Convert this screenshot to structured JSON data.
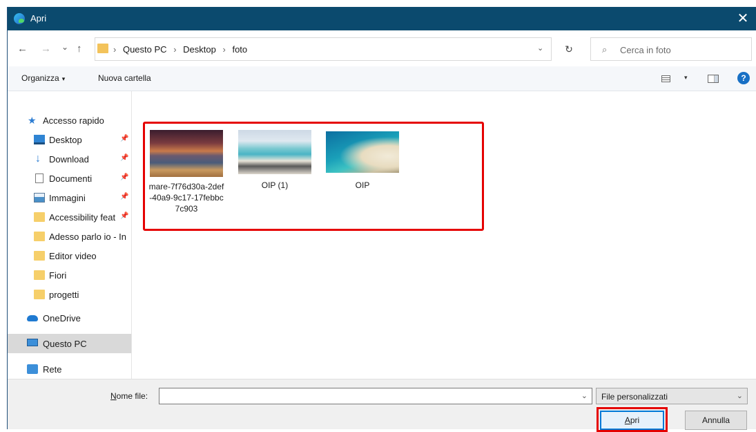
{
  "window": {
    "title": "Apri",
    "close_glyph": "✕"
  },
  "nav": {
    "back": "←",
    "forward": "→",
    "recent": "⌄",
    "up": "↑",
    "breadcrumb": [
      "Questo PC",
      "Desktop",
      "foto"
    ],
    "separator": "›",
    "dropdown": "⌄",
    "refresh": "↻",
    "search_placeholder": "Cerca in foto",
    "search_icon": "⌕"
  },
  "toolbar": {
    "organize": "Organizza",
    "organize_caret": "▾",
    "new_folder": "Nuova cartella",
    "view_caret": "▾",
    "help": "?"
  },
  "sidebar": {
    "items": [
      {
        "label": "Accesso rapido",
        "icon": "star-icon",
        "glyph": "★"
      },
      {
        "label": "Desktop",
        "icon": "desktop-icon",
        "pin": "📌"
      },
      {
        "label": "Download",
        "icon": "download-icon",
        "glyph": "↓",
        "pin": "📌"
      },
      {
        "label": "Documenti",
        "icon": "document-icon",
        "pin": "📌"
      },
      {
        "label": "Immagini",
        "icon": "pictures-icon",
        "pin": "📌"
      },
      {
        "label": "Accessibility feat",
        "icon": "folder-icon",
        "pin": "📌"
      },
      {
        "label": "Adesso parlo io - In",
        "icon": "folder-icon"
      },
      {
        "label": "Editor video",
        "icon": "folder-icon"
      },
      {
        "label": "Fiori",
        "icon": "folder-icon"
      },
      {
        "label": "progetti",
        "icon": "folder-icon"
      },
      {
        "label": "OneDrive",
        "icon": "onedrive-icon"
      },
      {
        "label": "Questo PC",
        "icon": "pc-icon",
        "selected": true
      },
      {
        "label": "Rete",
        "icon": "network-icon"
      }
    ]
  },
  "files": [
    {
      "name": "mare-7f76d30a-2def-40a9-9c17-17febbc7c903",
      "thumb": "sunset-beach"
    },
    {
      "name": "OIP (1)",
      "thumb": "beach-fence"
    },
    {
      "name": "OIP",
      "thumb": "aerial-beach"
    }
  ],
  "bottom": {
    "filename_label_u": "N",
    "filename_label_rest": "ome file:",
    "filename_value": "",
    "filename_dropdown": "⌄",
    "filter_value": "File personalizzati",
    "filter_dropdown": "⌄",
    "open_u": "A",
    "open_rest": "pri",
    "cancel": "Annulla"
  },
  "colors": {
    "titlebar": "#0b4a6e",
    "highlight": "#e50000",
    "selected": "#d9d9d9"
  }
}
